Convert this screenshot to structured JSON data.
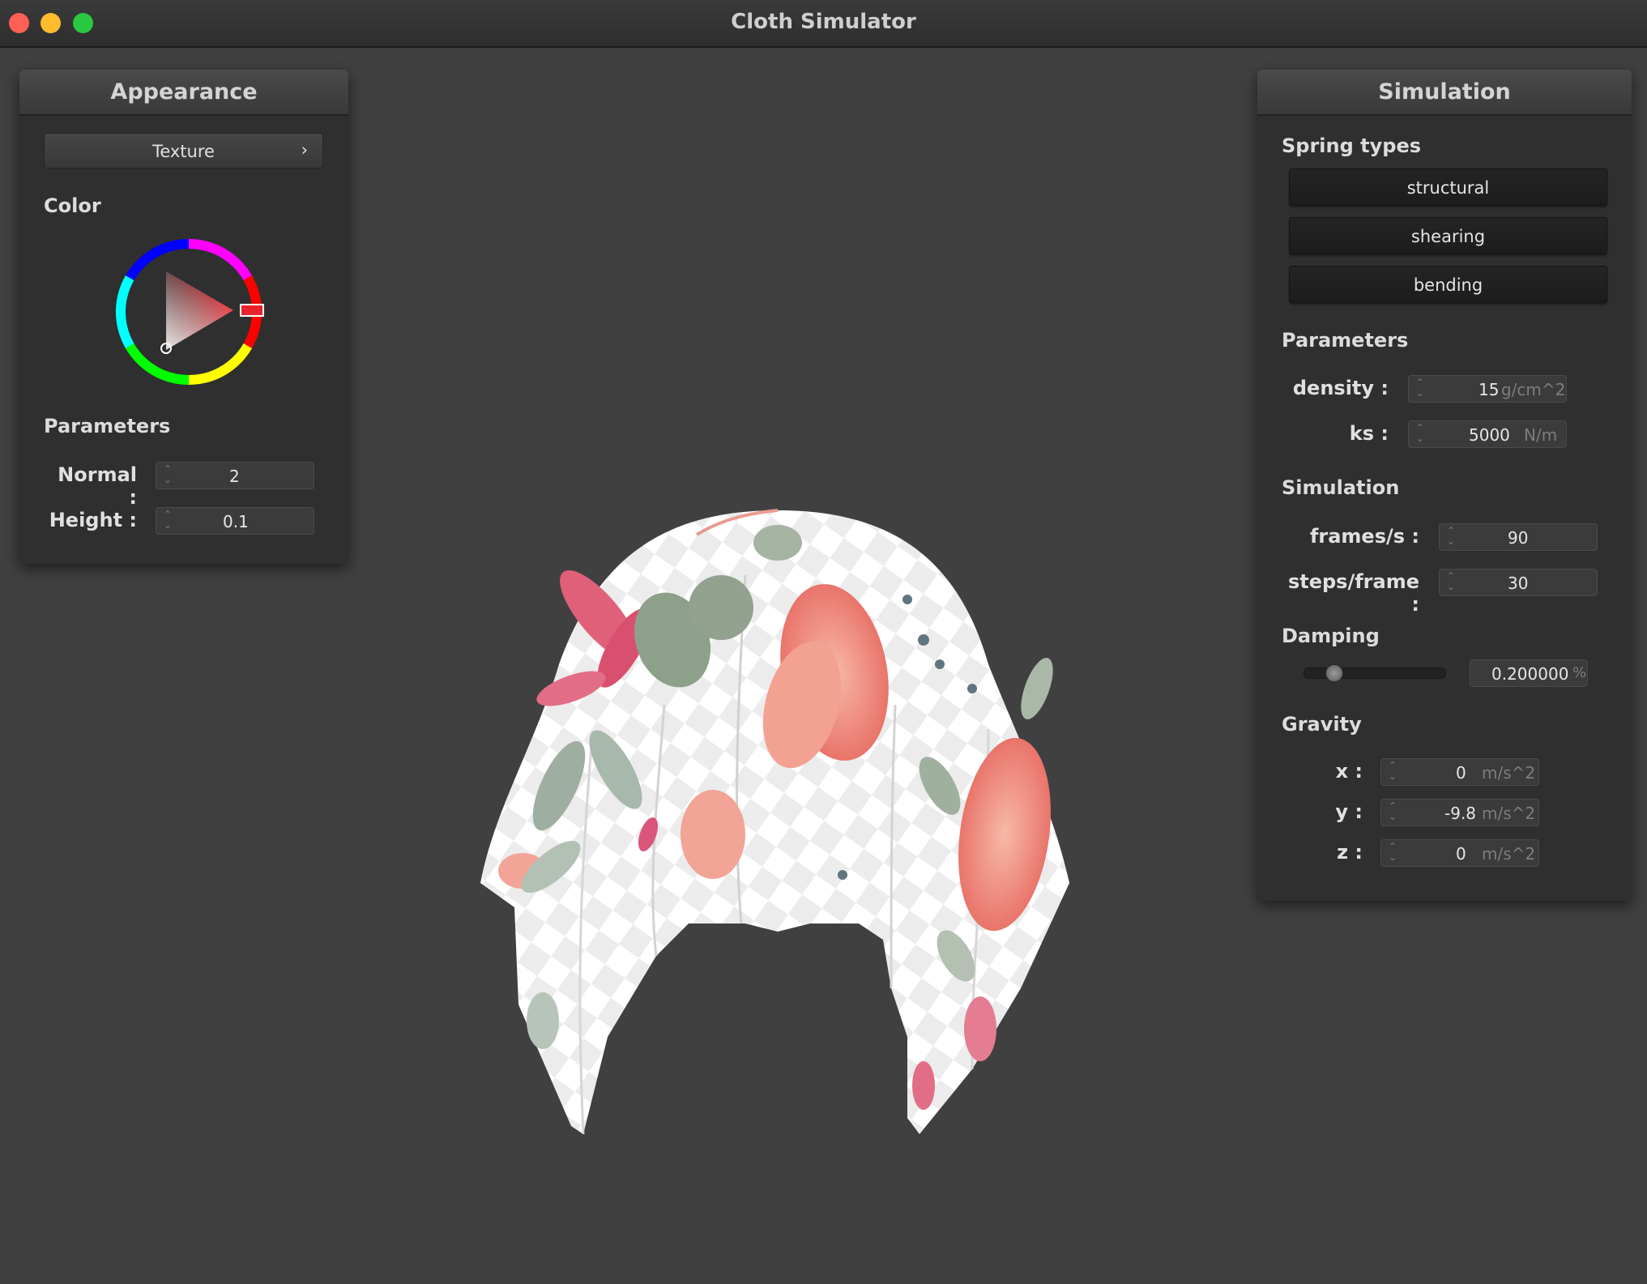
{
  "window": {
    "title": "Cloth Simulator"
  },
  "appearance": {
    "title": "Appearance",
    "texture_label": "Texture",
    "texture_arrow": "›",
    "color_heading": "Color",
    "params_heading": "Parameters",
    "selected_color": "#e8232b",
    "normal": {
      "label": "Normal :",
      "value": "2"
    },
    "height": {
      "label": "Height :",
      "value": "0.1"
    }
  },
  "simulation_panel": {
    "title": "Simulation",
    "spring_heading": "Spring types",
    "springs": [
      "structural",
      "shearing",
      "bending"
    ],
    "params_heading": "Parameters",
    "density": {
      "label": "density :",
      "value": "15",
      "unit": "g/cm^2"
    },
    "ks": {
      "label": "ks :",
      "value": "5000",
      "unit": "N/m"
    },
    "sim_heading": "Simulation",
    "fps": {
      "label": "frames/s :",
      "value": "90"
    },
    "steps": {
      "label": "steps/frame :",
      "value": "30"
    },
    "damping_heading": "Damping",
    "damping": {
      "value": "0.200000",
      "unit": "%",
      "slider_fraction": 0.2
    },
    "gravity_heading": "Gravity",
    "gx": {
      "label": "x :",
      "value": "0",
      "unit": "m/s^2"
    },
    "gy": {
      "label": "y :",
      "value": "-9.8",
      "unit": "m/s^2"
    },
    "gz": {
      "label": "z :",
      "value": "0",
      "unit": "m/s^2"
    }
  },
  "colors": {
    "background": "#404040",
    "panel": "#2f2f2f",
    "accent": "#e8232b"
  },
  "icons": {
    "spin_arrows": "⌃⌄",
    "window_controls": [
      "close",
      "minimize",
      "maximize"
    ]
  }
}
